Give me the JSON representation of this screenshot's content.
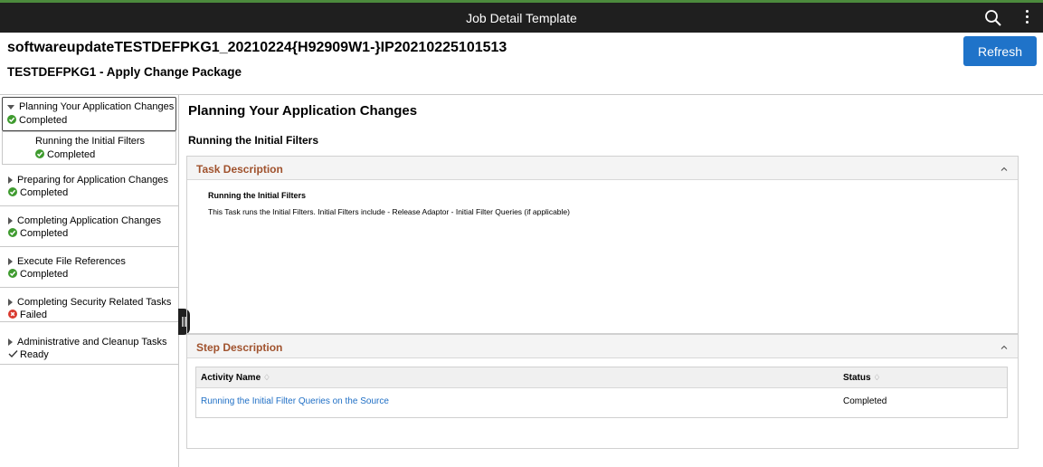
{
  "topbar": {
    "title": "Job Detail Template"
  },
  "header": {
    "job_name": "softwareupdateTESTDEFPKG1_20210224{H92909W1-}IP20210225101513",
    "package_title": "TESTDEFPKG1 - Apply Change Package",
    "refresh_label": "Refresh"
  },
  "sidebar": {
    "active": {
      "label": "Planning Your Application Changes",
      "status": "Completed"
    },
    "sub": {
      "label": "Running the Initial Filters",
      "status": "Completed"
    },
    "items": [
      {
        "label": "Preparing for Application Changes",
        "status": "Completed"
      },
      {
        "label": "Completing Application Changes",
        "status": "Completed"
      },
      {
        "label": "Execute File References",
        "status": "Completed"
      },
      {
        "label": "Completing Security Related Tasks",
        "status": "Failed"
      },
      {
        "label": "Administrative and Cleanup Tasks",
        "status": "Ready"
      }
    ]
  },
  "main": {
    "title": "Planning Your Application Changes",
    "subtitle": "Running the Initial Filters",
    "task_panel": {
      "header": "Task Description",
      "title": "Running the Initial Filters",
      "description": "This Task runs the Initial Filters. Initial Filters include - Release Adaptor - Initial Filter Queries (if applicable)"
    },
    "step_panel": {
      "header": "Step Description",
      "columns": [
        "Activity Name",
        "Status"
      ],
      "rows": [
        {
          "activity": "Running the Initial Filter Queries on the Source",
          "status": "Completed"
        }
      ]
    }
  },
  "colors": {
    "accent": "#1f73c9",
    "completed": "#3f9b2f",
    "failed": "#d93a2f",
    "panel_header_text": "#a0522d",
    "link": "#1f6fc5"
  },
  "icons": {
    "search": "search-icon",
    "menu": "more-vertical-icon",
    "completed": "check-circle-icon",
    "failed": "x-circle-icon",
    "ready": "checkmark-icon",
    "expand": "triangle-right-icon",
    "collapse": "triangle-down-icon",
    "panel_toggle": "chevron-up-icon",
    "sort": "sort-icon",
    "sidebar_handle": "pause-handle-icon"
  }
}
